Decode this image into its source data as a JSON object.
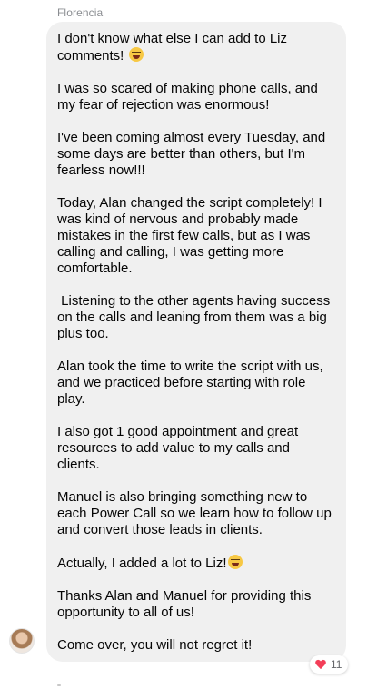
{
  "message": {
    "sender": "Florencia",
    "paragraphs": [
      "I don't know what else I can add to Liz comments! ",
      "I was so scared of making phone calls, and my fear of rejection was enormous!",
      "I've been coming almost every Tuesday, and some days are better than others, but I'm fearless now!!!",
      "Today, Alan changed the script completely! I was kind of nervous and probably made mistakes in the first few calls, but as I was calling and calling, I was getting more comfortable.",
      " Listening to the other agents having success on the calls and leaning from them was a big plus too.",
      "Alan took the time to write the script with us, and we practiced before starting with role play.",
      "I also got 1 good appointment and great resources to add value to my calls and clients.",
      "Manuel is also bringing something new to each Power Call so we learn how to follow up and convert those leads in clients.",
      "Actually, I added a lot to Liz!",
      "Thanks Alan and Manuel for providing this opportunity to all of us!",
      "Come over, you will not regret it!"
    ],
    "emoji_1": "grinning-squinting-face-icon",
    "emoji_2": "rolling-on-floor-laughing-icon"
  },
  "reaction": {
    "icon": "heart-icon",
    "count": "11",
    "color": "#f33e58"
  },
  "colors": {
    "bubble": "#f0f0f0",
    "text": "#050505",
    "sender": "#8a8d91"
  }
}
